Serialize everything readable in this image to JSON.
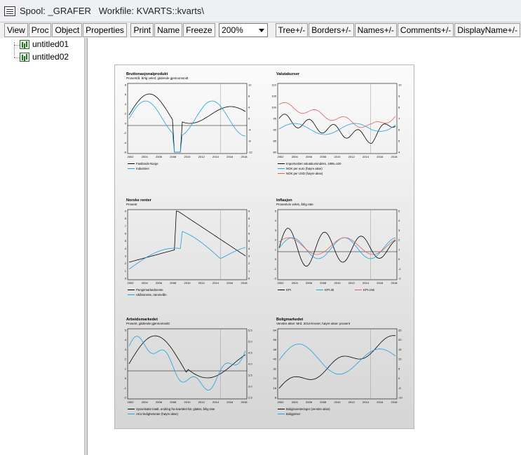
{
  "window": {
    "title": "Spool: _GRAFER   Workfile: KVARTS::kvarts\\"
  },
  "toolbar": {
    "buttons": [
      "View",
      "Proc",
      "Object",
      "Properties"
    ],
    "buttons2": [
      "Print",
      "Name",
      "Freeze"
    ],
    "zoom": "200%",
    "buttons3": [
      "Tree+/-",
      "Borders+/-",
      "Names+/-",
      "Comments+/-",
      "DisplayName+/-"
    ]
  },
  "tree": {
    "items": [
      "untitled01",
      "untitled02"
    ]
  },
  "colors": {
    "black": "#000000",
    "blue": "#1aa3d9",
    "red": "#e06060"
  },
  "panels": [
    {
      "title": "Bruttonasjonalprodukt",
      "subtitle": "Prosent/å. årlig vekst, glidende gjennomsnitt",
      "x_ticks": [
        "2002",
        "2004",
        "2006",
        "2008",
        "2010",
        "2012",
        "2014",
        "2016",
        "2018"
      ],
      "y_left": [
        "8",
        "6",
        "4",
        "2",
        "0",
        "-2",
        "-4",
        "-6"
      ],
      "y_right": [
        "12",
        "8",
        "4",
        "0",
        "-4",
        "-8",
        "-12"
      ],
      "legend": [
        "Fastlands-Norge",
        "Industrien"
      ],
      "legend_colors": [
        "#000000",
        "#1aa3d9"
      ]
    },
    {
      "title": "Valutakurser",
      "subtitle": "",
      "x_ticks": [
        "2002",
        "2004",
        "2006",
        "2008",
        "2010",
        "2012",
        "2014",
        "2016",
        "2018"
      ],
      "y_left": [
        "110",
        "105",
        "100",
        "95",
        "90",
        "85",
        "80"
      ],
      "y_right": [
        "10",
        "9",
        "8",
        "7",
        "6",
        "5",
        "4"
      ],
      "legend": [
        "Importvektet valutakursindeks, 1995=100",
        "NOK per euro (høyre akse)",
        "NOK per USD (høyre akse)"
      ],
      "legend_colors": [
        "#000000",
        "#1aa3d9",
        "#e06060"
      ]
    },
    {
      "title": "Norske renter",
      "subtitle": "Prosent",
      "x_ticks": [
        "2002",
        "2004",
        "2006",
        "2008",
        "2010",
        "2012",
        "2014",
        "2016",
        "2018"
      ],
      "y_left": [
        "9",
        "8",
        "7",
        "6",
        "5",
        "4",
        "3",
        "2",
        "1",
        "0"
      ],
      "y_right": [
        "9",
        "8",
        "7",
        "6",
        "5",
        "4",
        "3",
        "2",
        "1",
        "0"
      ],
      "legend": [
        "Pengemarkedsrente",
        "Utlånsrente, rammelån"
      ],
      "legend_colors": [
        "#000000",
        "#1aa3d9"
      ]
    },
    {
      "title": "Inflasjon",
      "subtitle": "Prosentvis vekst, årlig rate",
      "x_ticks": [
        "2002",
        "2004",
        "2006",
        "2008",
        "2010",
        "2012",
        "2014",
        "2016",
        "2018"
      ],
      "y_left": [
        "5",
        "4",
        "3",
        "2",
        "1",
        "0",
        "-1",
        "-2"
      ],
      "y_right": [
        "5",
        "4",
        "3",
        "2",
        "1",
        "0",
        "-1",
        "-2"
      ],
      "legend": [
        "KPI",
        "KPI-JE",
        "KPI-JAE"
      ],
      "legend_colors": [
        "#000000",
        "#1aa3d9",
        "#e06060"
      ]
    },
    {
      "title": "Arbeidsmarkedet",
      "subtitle": "Prosent, glidende gjennomsnitt",
      "x_ticks": [
        "2002",
        "2004",
        "2006",
        "2008",
        "2010",
        "2012",
        "2014",
        "2016",
        "2018"
      ],
      "y_left": [
        "5",
        "4",
        "3",
        "2",
        "1",
        "0",
        "-1",
        "-2"
      ],
      "y_right": [
        "5.5",
        "5.0",
        "4.5",
        "4.0",
        "3.5",
        "3.0",
        "2.5"
      ],
      "legend": [
        "Sysselsatte totalt, endring fra kvartalet før, glattet, årlig rate",
        "AKU ledighetsrate (høyre akse)"
      ],
      "legend_colors": [
        "#000000",
        "#1aa3d9"
      ]
    },
    {
      "title": "Boligmarkedet",
      "subtitle": "Venstre akse: Mrd. 2014-kroner, høyre akse: prosent",
      "x_ticks": [
        "2002",
        "2004",
        "2006",
        "2008",
        "2010",
        "2012",
        "2014",
        "2016",
        "2018"
      ],
      "y_left": [
        "64",
        "56",
        "48",
        "40",
        "32",
        "24",
        "16",
        "8"
      ],
      "y_right": [
        "25",
        "20",
        "15",
        "10",
        "5",
        "0",
        "-5",
        "-10"
      ],
      "legend": [
        "Boliginvesteringer (venstre akse)",
        "Boligpriser"
      ],
      "legend_colors": [
        "#000000",
        "#1aa3d9"
      ]
    }
  ]
}
